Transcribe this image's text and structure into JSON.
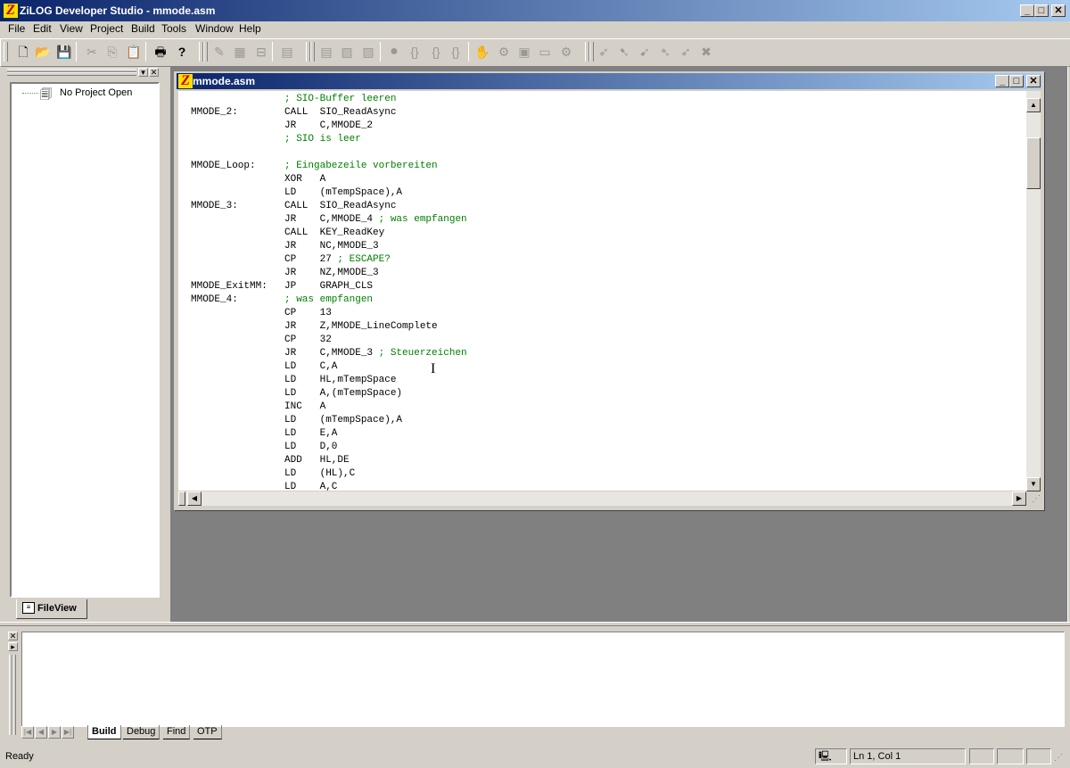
{
  "window": {
    "title": "ZiLOG Developer Studio - mmode.asm",
    "logo_letter": "Z"
  },
  "menu": [
    "File",
    "Edit",
    "View",
    "Project",
    "Build",
    "Tools",
    "Window",
    "Help"
  ],
  "toolbar": {
    "groups": [
      [
        "new-file-icon",
        "open-folder-icon",
        "save-icon"
      ],
      [
        "cut-icon",
        "copy-icon",
        "paste-icon"
      ],
      [
        "print-icon",
        "help-icon"
      ],
      [
        "compile-icon",
        "build-icon",
        "stop-build-icon"
      ],
      [
        "go-to-definition-icon"
      ],
      [
        "step-into-icon",
        "step-over-icon",
        "step-out-icon",
        "breakpoint-icon",
        "run-to-cursor-icon",
        "reset-icon"
      ],
      [
        "toggle-breakpoint-icon",
        "watch-icon",
        "memory-icon",
        "registers-icon",
        "disassembly-icon"
      ],
      [
        "go-icon",
        "break-icon",
        "stop-debug-icon"
      ]
    ]
  },
  "workspace": {
    "tree_item": "No Project Open",
    "tab_label": "FileView"
  },
  "document": {
    "title": "mmode.asm",
    "lines": [
      {
        "label": "",
        "code": "",
        "comment": "; SIO-Buffer leeren"
      },
      {
        "label": "MMODE_2:",
        "code": "CALL  SIO_ReadAsync",
        "comment": ""
      },
      {
        "label": "",
        "code": "JR    C,MMODE_2",
        "comment": ""
      },
      {
        "label": "",
        "code": "",
        "comment": "; SIO is leer"
      },
      {
        "label": "",
        "code": "",
        "comment": ""
      },
      {
        "label": "MMODE_Loop:",
        "code": "",
        "comment": "; Eingabezeile vorbereiten"
      },
      {
        "label": "",
        "code": "XOR   A",
        "comment": ""
      },
      {
        "label": "",
        "code": "LD    (mTempSpace),A",
        "comment": ""
      },
      {
        "label": "MMODE_3:",
        "code": "CALL  SIO_ReadAsync",
        "comment": ""
      },
      {
        "label": "",
        "code": "JR    C,MMODE_4 ",
        "comment": "; was empfangen"
      },
      {
        "label": "",
        "code": "CALL  KEY_ReadKey",
        "comment": ""
      },
      {
        "label": "",
        "code": "JR    NC,MMODE_3",
        "comment": ""
      },
      {
        "label": "",
        "code": "CP    27 ",
        "comment": "; ESCAPE?"
      },
      {
        "label": "",
        "code": "JR    NZ,MMODE_3",
        "comment": ""
      },
      {
        "label": "MMODE_ExitMM:",
        "code": "JP    GRAPH_CLS",
        "comment": ""
      },
      {
        "label": "MMODE_4:",
        "code": "",
        "comment": "; was empfangen"
      },
      {
        "label": "",
        "code": "CP    13",
        "comment": ""
      },
      {
        "label": "",
        "code": "JR    Z,MMODE_LineComplete",
        "comment": ""
      },
      {
        "label": "",
        "code": "CP    32",
        "comment": ""
      },
      {
        "label": "",
        "code": "JR    C,MMODE_3 ",
        "comment": "; Steuerzeichen"
      },
      {
        "label": "",
        "code": "LD    C,A",
        "comment": ""
      },
      {
        "label": "",
        "code": "LD    HL,mTempSpace",
        "comment": ""
      },
      {
        "label": "",
        "code": "LD    A,(mTempSpace)",
        "comment": ""
      },
      {
        "label": "",
        "code": "INC   A",
        "comment": ""
      },
      {
        "label": "",
        "code": "LD    (mTempSpace),A",
        "comment": ""
      },
      {
        "label": "",
        "code": "LD    E,A",
        "comment": ""
      },
      {
        "label": "",
        "code": "LD    D,0",
        "comment": ""
      },
      {
        "label": "",
        "code": "ADD   HL,DE",
        "comment": ""
      },
      {
        "label": "",
        "code": "LD    (HL),C",
        "comment": ""
      },
      {
        "label": "",
        "code": "LD    A,C",
        "comment": ""
      }
    ]
  },
  "output": {
    "tabs": [
      "Build",
      "Debug",
      "Find",
      "OTP"
    ],
    "active_tab": "Build"
  },
  "status": {
    "text": "Ready",
    "position": "Ln 1, Col 1"
  },
  "colors": {
    "titlebar": "#0a246a",
    "comment": "#008000",
    "face": "#d4d0c8",
    "mdi_background": "#808080"
  }
}
